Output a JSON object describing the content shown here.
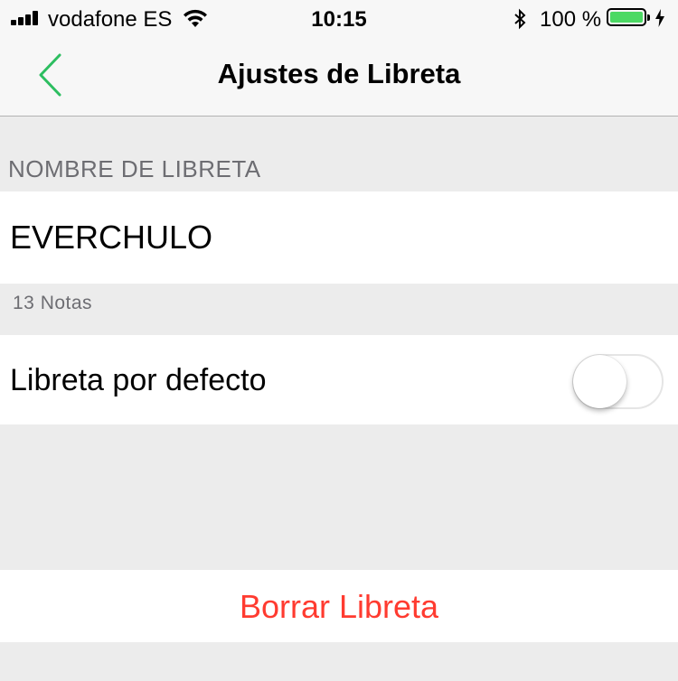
{
  "status_bar": {
    "carrier": "vodafone ES",
    "time": "10:15",
    "battery_percent": "100 %",
    "battery_level": 1.0,
    "battery_color": "#4cd964",
    "icons": [
      "signal-icon",
      "wifi-icon",
      "bluetooth-icon",
      "battery-icon",
      "charging-icon"
    ]
  },
  "nav": {
    "title": "Ajustes de Libreta",
    "back_icon": "chevron-left-icon",
    "accent_color": "#2dbe60"
  },
  "notebook_name": {
    "header": "NOMBRE DE LIBRETA",
    "value": "EVERCHULO",
    "footer": "13 Notas"
  },
  "default_notebook": {
    "label": "Libreta por defecto",
    "toggle_on": false
  },
  "delete": {
    "label": "Borrar Libreta",
    "color": "#ff3b30"
  }
}
